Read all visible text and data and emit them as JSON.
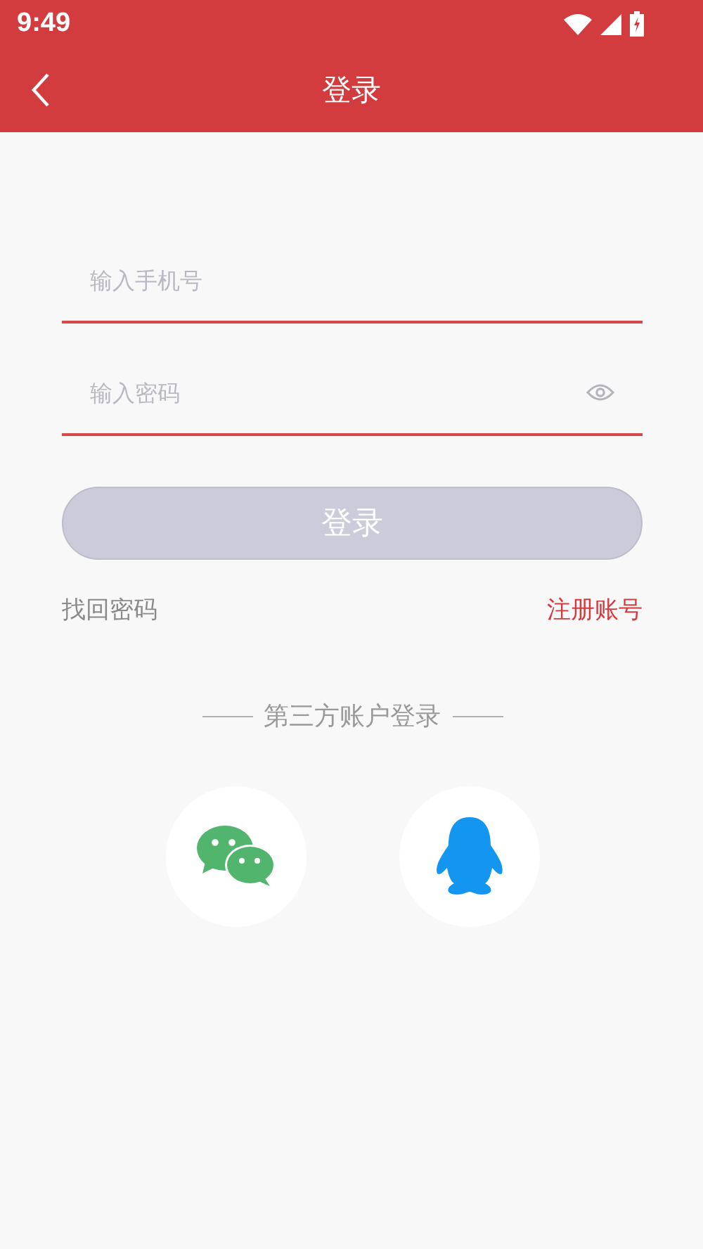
{
  "status_bar": {
    "time": "9:49"
  },
  "app_bar": {
    "title": "登录"
  },
  "fields": [
    {
      "kind": "phone",
      "placeholder": "输入手机号"
    },
    {
      "kind": "password",
      "placeholder": "输入密码"
    }
  ],
  "login_button": {
    "label": "登录",
    "disabled": true
  },
  "links": {
    "left": "找回密码",
    "right": "注册账号"
  },
  "third_party": {
    "label": "第三方账户登录",
    "options": [
      {
        "kind": "chat"
      },
      {
        "kind": "penguin"
      }
    ]
  }
}
